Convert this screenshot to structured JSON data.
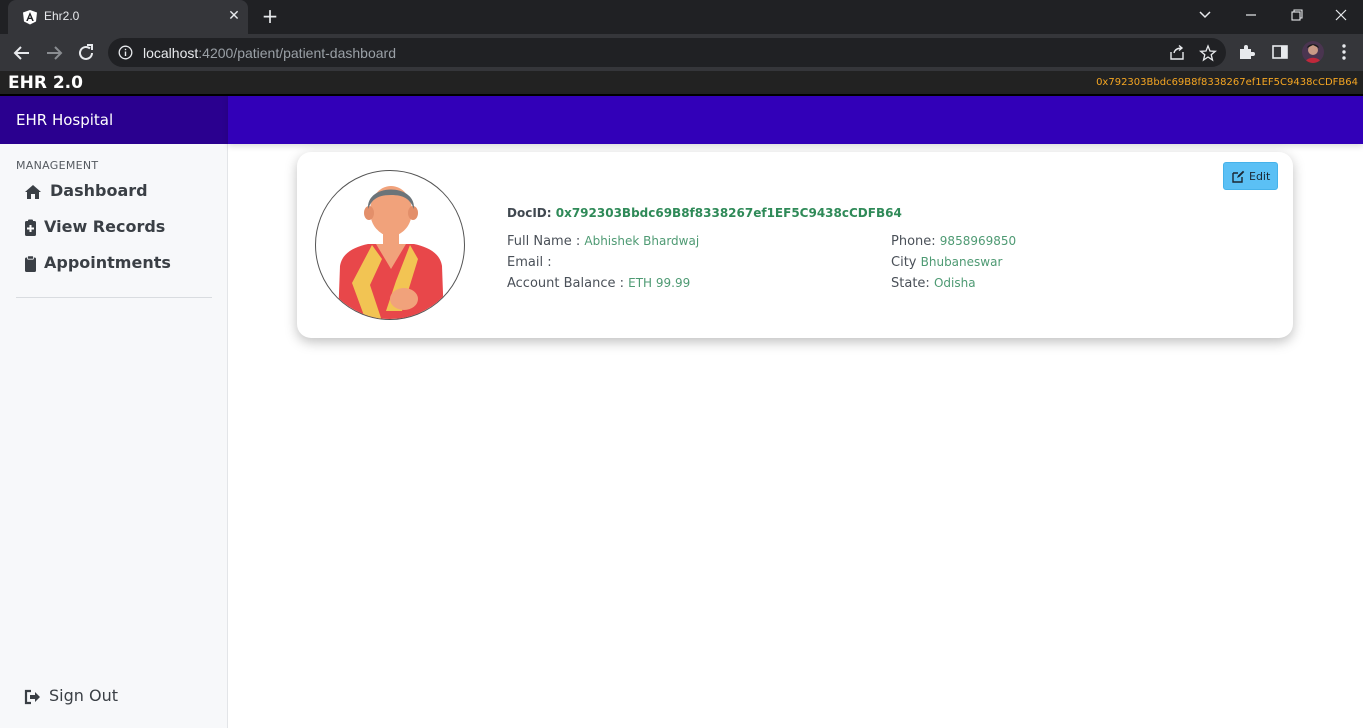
{
  "browser": {
    "tab_title": "Ehr2.0",
    "url_host": "localhost",
    "url_rest": ":4200/patient/patient-dashboard"
  },
  "app": {
    "brand": "EHR 2.0",
    "account_address": "0x792303Bbdc69B8f8338267ef1EF5C9438cCDFB64"
  },
  "sidebar": {
    "brand": "EHR Hospital",
    "section_label": "MANAGEMENT",
    "items": [
      {
        "label": "Dashboard",
        "icon": "home-icon"
      },
      {
        "label": "View Records",
        "icon": "medical-file-icon"
      },
      {
        "label": "Appointments",
        "icon": "clipboard-icon"
      }
    ],
    "signout_label": "Sign Out"
  },
  "profile": {
    "edit_label": "Edit",
    "docid_label": "DocID:",
    "docid_value": "0x792303Bbdc69B8f8338267ef1EF5C9438cCDFB64",
    "full_name_label": "Full Name :",
    "full_name": "Abhishek Bhardwaj",
    "email_label": "Email :",
    "email": "",
    "balance_label": "Account Balance :",
    "balance": "ETH 99.99",
    "phone_label": "Phone:",
    "phone": "9858969850",
    "city_label": "City",
    "city": "Bhubaneswar",
    "state_label": "State:",
    "state": "Odisha"
  },
  "colors": {
    "sidebar_header": "#2a008f",
    "main_header": "#3200b8",
    "accent_value": "#4e9a73",
    "edit_button": "#5bc0f5"
  }
}
